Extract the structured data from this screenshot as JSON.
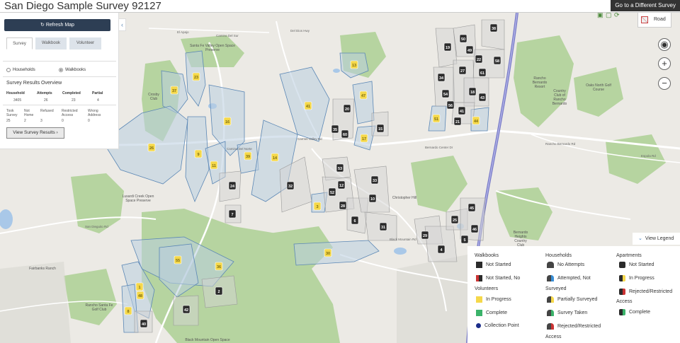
{
  "title": "San Diego Sample Survey 92127",
  "different_survey": "Go to a Different Survey",
  "panel": {
    "refresh": "Refresh Map",
    "tabs": [
      "Survey",
      "Walkbook",
      "Volunteer"
    ],
    "radio_households": "Households",
    "radio_walkbooks": "Walkbooks",
    "overview_title": "Survey Results Overview",
    "stats": [
      {
        "h": "Household",
        "v": "3405"
      },
      {
        "h": "Attempts",
        "v": "26"
      },
      {
        "h": "Completed",
        "v": "23"
      },
      {
        "h": "Partial",
        "v": "4"
      }
    ],
    "stats2": [
      {
        "l1": "Took",
        "l2": "Survey",
        "v": "25"
      },
      {
        "l1": "Not",
        "l2": "Home",
        "v": "2"
      },
      {
        "l1": "Refused",
        "l2": "",
        "v": "3"
      },
      {
        "l1": "Restricted",
        "l2": "Access",
        "v": "0"
      },
      {
        "l1": "Wrong",
        "l2": "Address",
        "v": "0"
      }
    ],
    "view_results": "View Survey Results ›"
  },
  "map": {
    "road_label": "Road",
    "places": [
      "Santa Fe Valley Open Space",
      "Preserve",
      "Crosby",
      "Club",
      "Lusardi Creek Open",
      "Space Preserve",
      "Fairbanks Ranch",
      "Rancho Santa Fe",
      "Golf Club",
      "Black Mountain Open Space",
      "Christopher Hill",
      "Rancho",
      "Bernardo",
      "Resort",
      "Country",
      "Club of",
      "Rancho",
      "Bernardo",
      "Oaks North Golf",
      "Course",
      "Bernardo",
      "Heights",
      "Country",
      "Club"
    ],
    "roads": [
      "Camino Del Sur",
      "Carmel Valley Rd",
      "Camino Del Norte",
      "Espola Rd",
      "Del Dios Hwy",
      "El Apajo",
      "San Dieguito Rd",
      "Black Mountain Rd",
      "Bernardo Center Dr",
      "Rancho Bernardo Rd"
    ],
    "walkbooks_dark": [
      "38",
      "50",
      "19",
      "49",
      "22",
      "58",
      "27",
      "61",
      "34",
      "18",
      "54",
      "43",
      "56",
      "41",
      "21",
      "20",
      "35",
      "60",
      "15",
      "53",
      "33",
      "12",
      "52",
      "28",
      "10",
      "6",
      "31",
      "24",
      "32",
      "7",
      "29",
      "45",
      "25",
      "46",
      "5",
      "4",
      "2",
      "42",
      "40"
    ],
    "walkbooks_yellow": [
      "23",
      "37",
      "26",
      "13",
      "41",
      "16",
      "47",
      "9",
      "11",
      "39",
      "14",
      "17",
      "51",
      "44",
      "3",
      "30",
      "55",
      "1",
      "8",
      "36",
      "48"
    ]
  },
  "legend_toggle": "View Legend",
  "legend": {
    "walkbooks_h": "Walkbooks",
    "walkbooks": [
      "Not Started",
      "Not Started, No"
    ],
    "volunteers_h": "Volunteers",
    "volunteers": [
      "In Progress",
      "Complete",
      "Collection Point"
    ],
    "households_h": "Households",
    "households": [
      "No Attempts",
      "Attempted, Not",
      "Surveyed",
      "Partially Surveyed",
      "Survey Taken",
      "Rejected/Restricted",
      "Access"
    ],
    "apartments_h": "Apartments",
    "apartments": [
      "Not Started",
      "In Progress",
      "Rejected/Restricted",
      "Access",
      "Complete"
    ]
  },
  "colors": {
    "dark_marker": "#2b2b2b",
    "yellow_marker": "#f5d84a",
    "polygon_fill": "#b9cde0",
    "polygon_stroke": "#5b87b5",
    "park": "#b6d4a0",
    "water": "#a9c8e8",
    "navy": "#2d3e54"
  }
}
